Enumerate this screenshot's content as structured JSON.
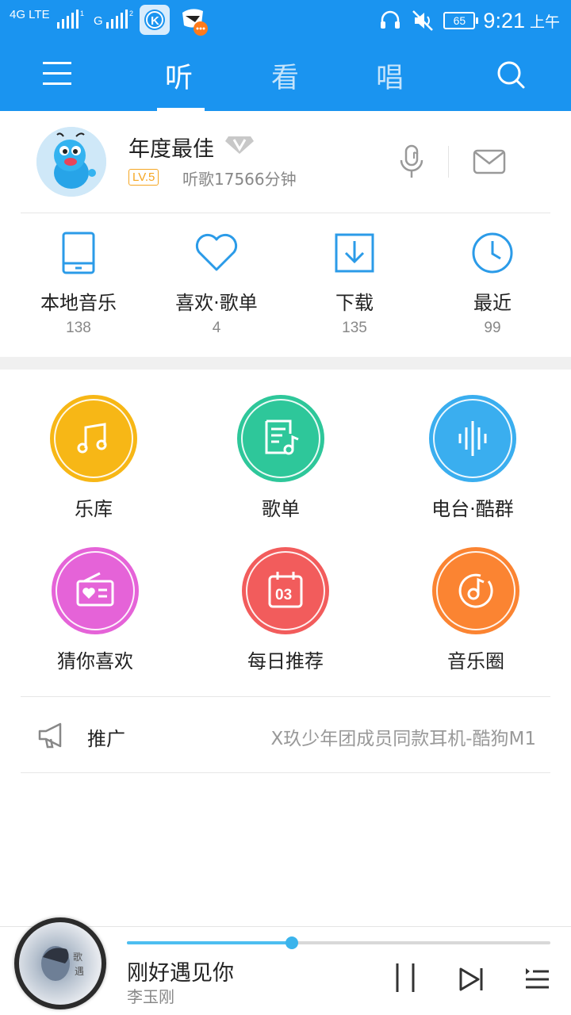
{
  "status_bar": {
    "network_label": "4G LTE",
    "sim1": "1",
    "sim2_label": "G",
    "sim2": "2",
    "battery": "65",
    "time": "9:21",
    "ampm": "上午"
  },
  "nav": {
    "tabs": [
      {
        "label": "听",
        "active": true
      },
      {
        "label": "看",
        "active": false
      },
      {
        "label": "唱",
        "active": false
      }
    ]
  },
  "profile": {
    "name": "年度最佳",
    "level": "LV.5",
    "listen_time": "听歌17566分钟"
  },
  "quick_items": [
    {
      "label": "本地音乐",
      "count": "138",
      "icon": "phone-icon"
    },
    {
      "label": "喜欢·歌单",
      "count": "4",
      "icon": "heart-icon"
    },
    {
      "label": "下载",
      "count": "135",
      "icon": "download-icon"
    },
    {
      "label": "最近",
      "count": "99",
      "icon": "clock-icon"
    }
  ],
  "grid": [
    {
      "label": "乐库",
      "color": "#f7b716",
      "icon": "music-note-icon"
    },
    {
      "label": "歌单",
      "color": "#2ec79a",
      "icon": "playlist-icon"
    },
    {
      "label": "电台·酷群",
      "color": "#3aaeef",
      "icon": "soundwave-icon"
    },
    {
      "label": "猜你喜欢",
      "color": "#e563d8",
      "icon": "radio-heart-icon"
    },
    {
      "label": "每日推荐",
      "color": "#f25c5c",
      "icon": "calendar-icon",
      "day": "03"
    },
    {
      "label": "音乐圈",
      "color": "#fb8432",
      "icon": "music-circle-icon"
    }
  ],
  "promo": {
    "label": "推广",
    "text": "X玖少年团成员同款耳机-酷狗M1"
  },
  "player": {
    "title": "刚好遇见你",
    "artist": "李玉刚",
    "progress": 0.39
  },
  "colors": {
    "brand": "#1a94f0",
    "icon_blue": "#2b9be8",
    "progress": "#4dbef0"
  }
}
